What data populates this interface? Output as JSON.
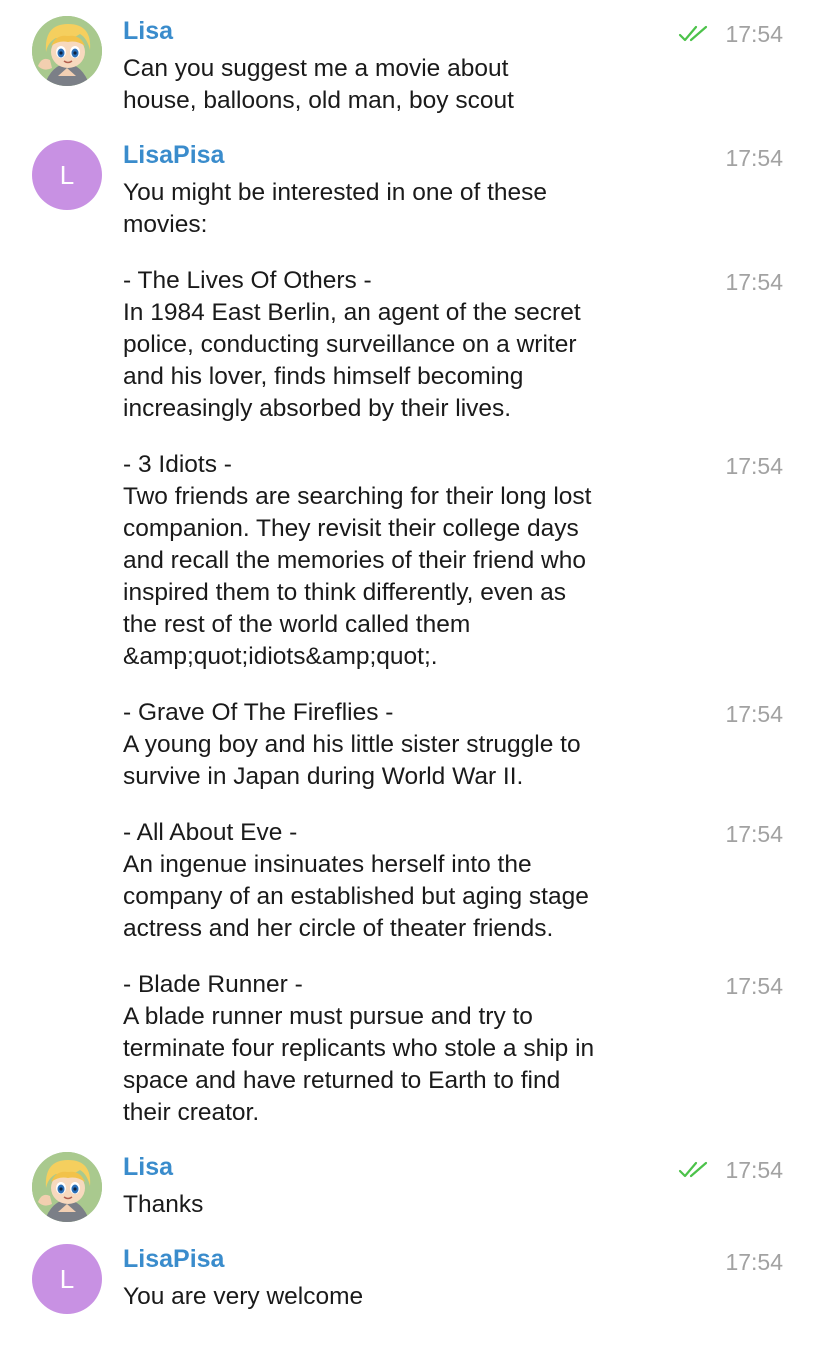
{
  "messages": [
    {
      "sender": "Lisa",
      "text": "Can you suggest me a movie about\nhouse, balloons, old man, boy scout",
      "time": "17:54",
      "read": true
    },
    {
      "sender": "LisaPisa",
      "avatar_letter": "L",
      "text": "You might be interested in one of these\nmovies:",
      "time": "17:54"
    },
    {
      "text": "- The Lives Of Others -\nIn 1984 East Berlin, an agent of the secret\npolice, conducting surveillance on a writer\nand his lover, finds himself becoming\nincreasingly absorbed by their lives.",
      "time": "17:54"
    },
    {
      "text": "- 3 Idiots -\nTwo friends are searching for their long lost\ncompanion. They revisit their college days\nand recall the memories of their friend who\ninspired them to think differently, even as\nthe rest of the world called them\n&amp;quot;idiots&amp;quot;.",
      "time": "17:54"
    },
    {
      "text": "- Grave Of The Fireflies -\nA young boy and his little sister struggle to\nsurvive in Japan during World War II.",
      "time": "17:54"
    },
    {
      "text": "- All About Eve -\nAn ingenue insinuates herself into the\ncompany of an established but aging stage\nactress and her circle of theater friends.",
      "time": "17:54"
    },
    {
      "text": "- Blade Runner -\nA blade runner must pursue and try to\nterminate four replicants who stole a ship in\nspace and have returned to Earth to find\ntheir creator.",
      "time": "17:54"
    },
    {
      "sender": "Lisa",
      "text": "Thanks",
      "time": "17:54",
      "read": true
    },
    {
      "sender": "LisaPisa",
      "avatar_letter": "L",
      "text": "You are very welcome",
      "time": "17:54"
    }
  ],
  "colors": {
    "sender_name": "#3a8ccc",
    "timestamp": "#a2a2a2",
    "read_check": "#4cc24a",
    "avatar_bot": "#c891e3"
  },
  "icons": {
    "read_receipt": "double-check-icon",
    "user_avatar": "cartoon-girl-avatar"
  }
}
